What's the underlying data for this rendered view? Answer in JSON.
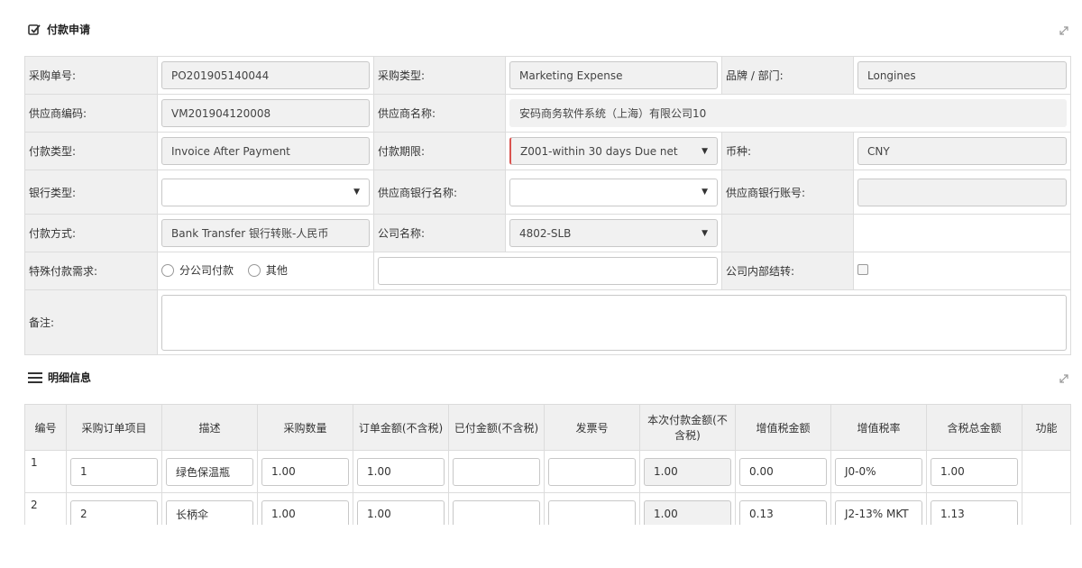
{
  "section1": {
    "title": "付款申请"
  },
  "section2": {
    "title": "明细信息"
  },
  "form": {
    "po_no_label": "采购单号:",
    "po_no": "PO201905140044",
    "po_type_label": "采购类型:",
    "po_type": "Marketing Expense",
    "brand_label": "品牌 / 部门:",
    "brand": "Longines",
    "vendor_code_label": "供应商编码:",
    "vendor_code": "VM201904120008",
    "vendor_name_label": "供应商名称:",
    "vendor_name": "安码商务软件系统（上海）有限公司10",
    "pay_type_label": "付款类型:",
    "pay_type": "Invoice After Payment",
    "pay_term_label": "付款期限:",
    "pay_term": "Z001-within 30 days Due net",
    "currency_label": "币种:",
    "currency": "CNY",
    "bank_type_label": "银行类型:",
    "bank_type": "",
    "vendor_bank_label": "供应商银行名称:",
    "vendor_bank": "",
    "vendor_account_label": "供应商银行账号:",
    "vendor_account": "",
    "pay_method_label": "付款方式:",
    "pay_method": "Bank Transfer 银行转账-人民币",
    "company_label": "公司名称:",
    "company": "4802-SLB",
    "special_label": "特殊付款需求:",
    "radio1": "分公司付款",
    "radio2": "其他",
    "special_text": "",
    "internal_label": "公司内部结转:",
    "remark_label": "备注:",
    "remark": ""
  },
  "detail": {
    "headers": [
      "编号",
      "采购订单项目",
      "描述",
      "采购数量",
      "订单金额(不含税)",
      "已付金额(不含税)",
      "发票号",
      "本次付款金额(不含税)",
      "增值税金额",
      "增值税率",
      "含税总金额",
      "功能"
    ],
    "rows": [
      {
        "no": "1",
        "item": "1",
        "desc": "绿色保温瓶",
        "qty": "1.00",
        "order_amt": "1.00",
        "paid_amt": "",
        "invoice": "",
        "pay_amt": "1.00",
        "vat_amt": "0.00",
        "vat_rate": "J0-0%",
        "total": "1.00"
      },
      {
        "no": "2",
        "item": "2",
        "desc": "长柄伞",
        "qty": "1.00",
        "order_amt": "1.00",
        "paid_amt": "",
        "invoice": "",
        "pay_amt": "1.00",
        "vat_amt": "0.13",
        "vat_rate": "J2-13% MKT",
        "total": "1.13"
      }
    ]
  },
  "icons": {
    "section1": "checkbox-edit-icon",
    "section2": "list-icon",
    "expand": "expand-icon"
  }
}
